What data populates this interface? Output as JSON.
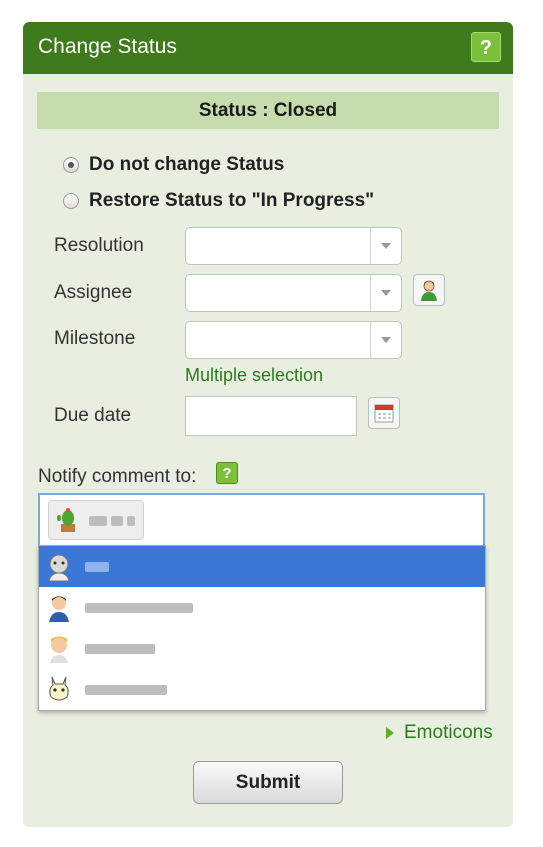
{
  "header": {
    "title": "Change Status",
    "help_glyph": "?"
  },
  "status": {
    "text": "Status : Closed"
  },
  "radios": [
    {
      "label": "Do not change Status",
      "checked": true
    },
    {
      "label": "Restore Status to \"In Progress\"",
      "checked": false
    }
  ],
  "fields": {
    "resolution_label": "Resolution",
    "assignee_label": "Assignee",
    "milestone_label": "Milestone",
    "multiple_selection": "Multiple selection",
    "due_date_label": "Due date"
  },
  "notify": {
    "label": "Notify comment to:",
    "help_glyph": "?"
  },
  "emoticons": {
    "label": "Emoticons"
  },
  "submit": {
    "label": "Submit"
  },
  "icons": {
    "help": "help-icon",
    "user": "user-icon",
    "calendar": "calendar-icon",
    "dropdown": "chevron-down-icon",
    "expand": "triangle-right-icon"
  },
  "colors": {
    "header_bg": "#3f7a1c",
    "panel_bg": "#e9efe0",
    "status_bar_bg": "#c7dcae",
    "accent_green": "#7cc03a",
    "link_green": "#2d7a1f",
    "selected_row": "#3b78d5"
  }
}
